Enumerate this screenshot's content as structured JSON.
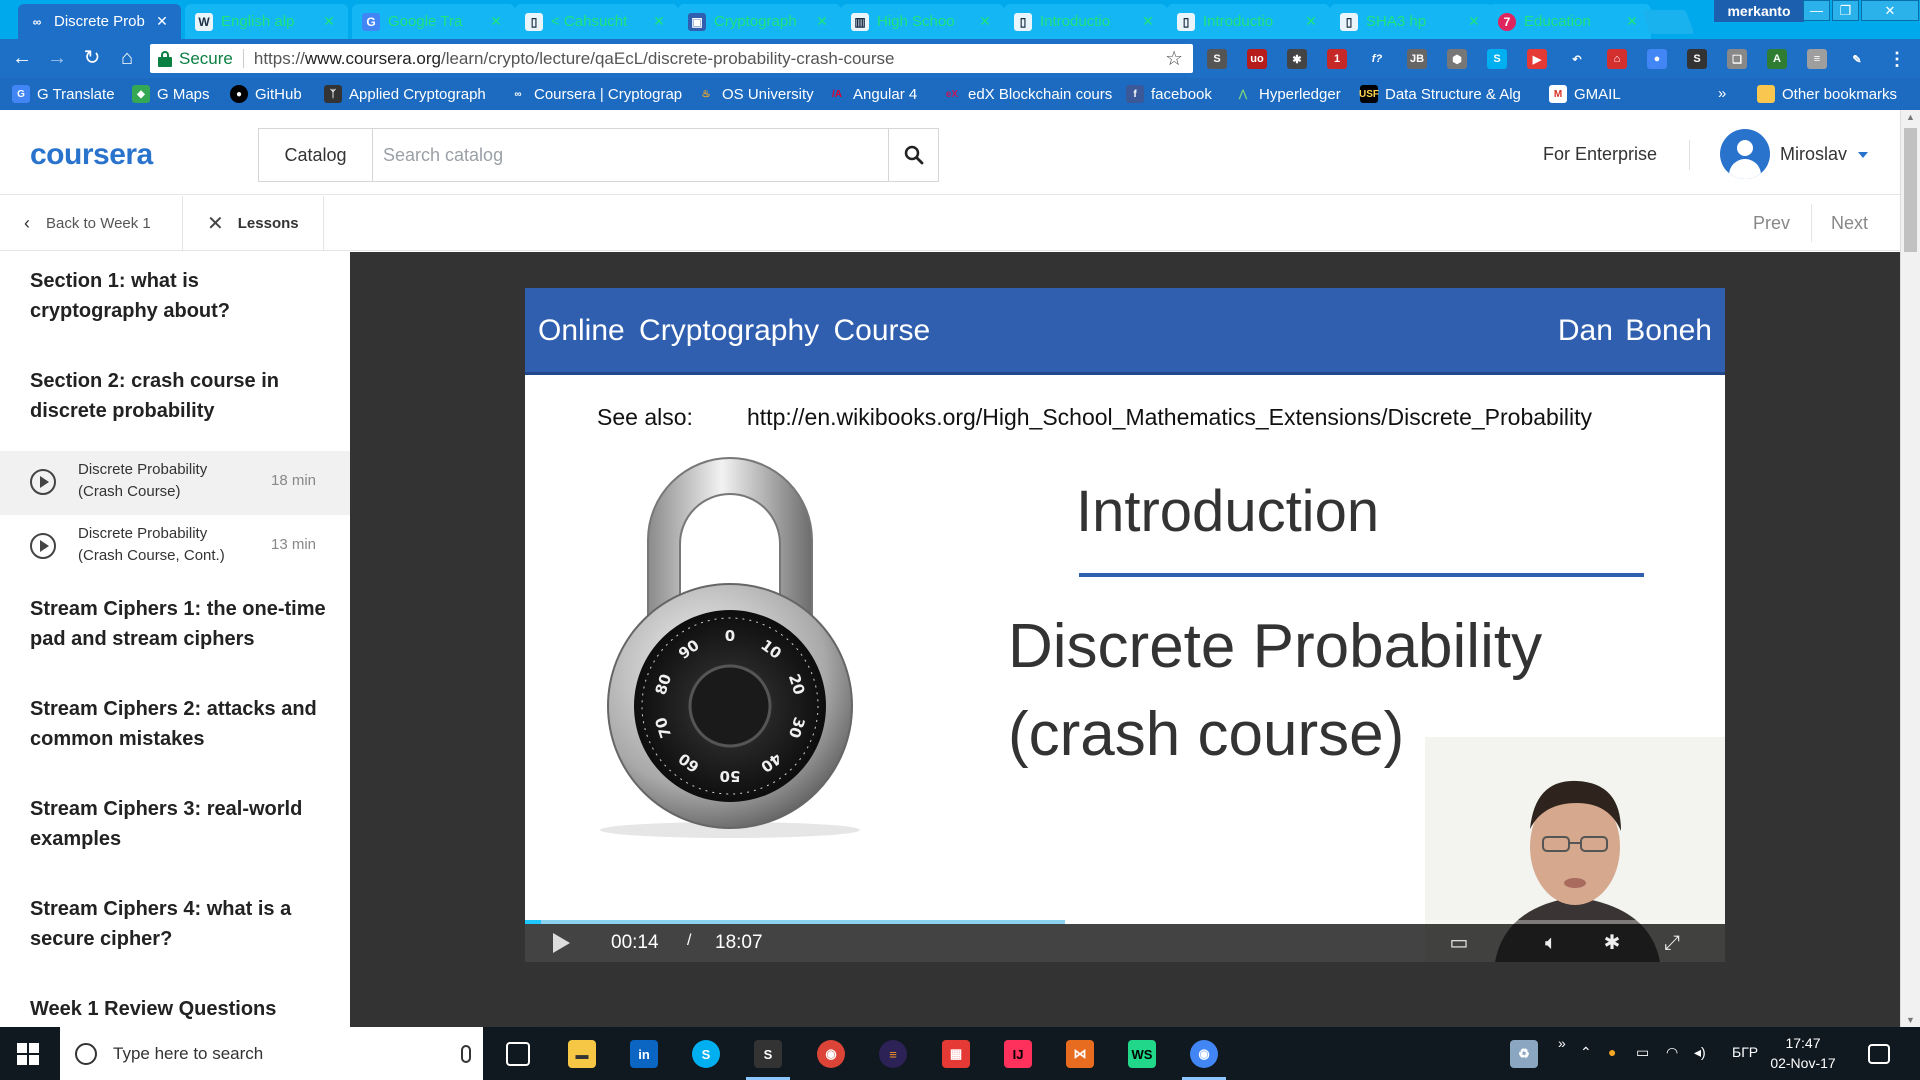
{
  "browser": {
    "tabs": [
      {
        "title": "Discrete Prob",
        "favicon": "coursera-icon"
      },
      {
        "title": "English alp",
        "favicon": "wikipedia-icon"
      },
      {
        "title": "Google Tra",
        "favicon": "google-translate-icon"
      },
      {
        "title": "< Cahsucht",
        "favicon": "page-icon"
      },
      {
        "title": "Cryptograph",
        "favicon": "app-icon"
      },
      {
        "title": "High Schoo",
        "favicon": "wikibooks-icon"
      },
      {
        "title": "Introductio",
        "favicon": "page-icon"
      },
      {
        "title": "Introductio",
        "favicon": "page-icon"
      },
      {
        "title": "SHA3 hp",
        "favicon": "page-icon"
      },
      {
        "title": "Education",
        "favicon": "seven-icon"
      }
    ],
    "user": "merkanto",
    "address": {
      "secure_label": "Secure",
      "url_scheme": "https://",
      "url_host": "www.coursera.org",
      "url_path": "/learn/crypto/lecture/qaEcL/discrete-probability-crash-course"
    },
    "bookmarks": [
      {
        "label": "G Translate",
        "icon": "google-translate-icon",
        "color": "#4285f4"
      },
      {
        "label": "G Maps",
        "icon": "google-maps-icon",
        "color": "#34a853"
      },
      {
        "label": "GitHub",
        "icon": "github-icon",
        "color": "#000000"
      },
      {
        "label": "Applied Cryptograph",
        "icon": "figure-icon",
        "color": "#333333"
      },
      {
        "label": "Coursera | Cryptograp",
        "icon": "coursera-icon",
        "color": "#ffffff"
      },
      {
        "label": "OS University",
        "icon": "flame-icon",
        "color": "#f5a623"
      },
      {
        "label": "Angular 4",
        "icon": "angular-icon",
        "color": "#dd0031"
      },
      {
        "label": "edX Blockchain cours",
        "icon": "edx-icon",
        "color": "#02262b"
      },
      {
        "label": "facebook",
        "icon": "facebook-icon",
        "color": "#3b5998"
      },
      {
        "label": "Hyperledger",
        "icon": "hyperledger-icon",
        "color": "#2f3134"
      },
      {
        "label": "Data Structure & Alg",
        "icon": "usf-icon",
        "color": "#006747"
      },
      {
        "label": "GMAIL",
        "icon": "gmail-icon",
        "color": "#d93025"
      }
    ],
    "overflow_label": "»",
    "other_bookmarks": "Other bookmarks"
  },
  "header": {
    "logo": "coursera",
    "catalog_label": "Catalog",
    "search_placeholder": "Search catalog",
    "enterprise_label": "For Enterprise",
    "user_name": "Miroslav"
  },
  "subnav": {
    "back_label": "Back to Week 1",
    "lessons_label": "Lessons",
    "prev_label": "Prev",
    "next_label": "Next"
  },
  "sidebar": {
    "sections": [
      "Section 1: what is cryptography about?",
      "Section 2: crash course in discrete probability",
      "Stream Ciphers 1: the one-time pad and stream ciphers",
      "Stream Ciphers 2: attacks and common mistakes",
      "Stream Ciphers 3: real-world examples",
      "Stream Ciphers 4: what is a secure cipher?",
      "Week 1 Review Questions"
    ],
    "items": [
      {
        "title": "Discrete Probability (Crash Course)",
        "duration": "18 min",
        "active": true
      },
      {
        "title": "Discrete Probability (Crash Course, Cont.)",
        "duration": "13 min",
        "active": false
      }
    ]
  },
  "slide": {
    "banner_left": "Online  Cryptography  Course",
    "banner_right": "Dan  Boneh",
    "see_also_label": "See also:",
    "see_also_url": "http://en.wikibooks.org/High_School_Mathematics_Extensions/Discrete_Probability",
    "heading": "Introduction",
    "title_line1": "Discrete Probability",
    "title_line2": "(crash course)",
    "dial_numbers": [
      "0",
      "10",
      "20",
      "30",
      "40",
      "50",
      "60",
      "70",
      "80",
      "90"
    ]
  },
  "player": {
    "current_time": "00:14",
    "separator": "/",
    "duration": "18:07",
    "progress_fraction": 0.013,
    "buffered_fraction": 0.45
  },
  "lecture_title": "Discrete Probability (Crash Course)",
  "taskbar": {
    "search_placeholder": "Type here to search",
    "language": "БГР",
    "time": "17:47",
    "date": "02-Nov-17",
    "overflow": "»"
  },
  "colors": {
    "coursera_blue": "#2a73cc",
    "chrome_active_tab": "#1d6fc8",
    "slide_banner": "#2f5fae",
    "player_stage": "#333333"
  }
}
